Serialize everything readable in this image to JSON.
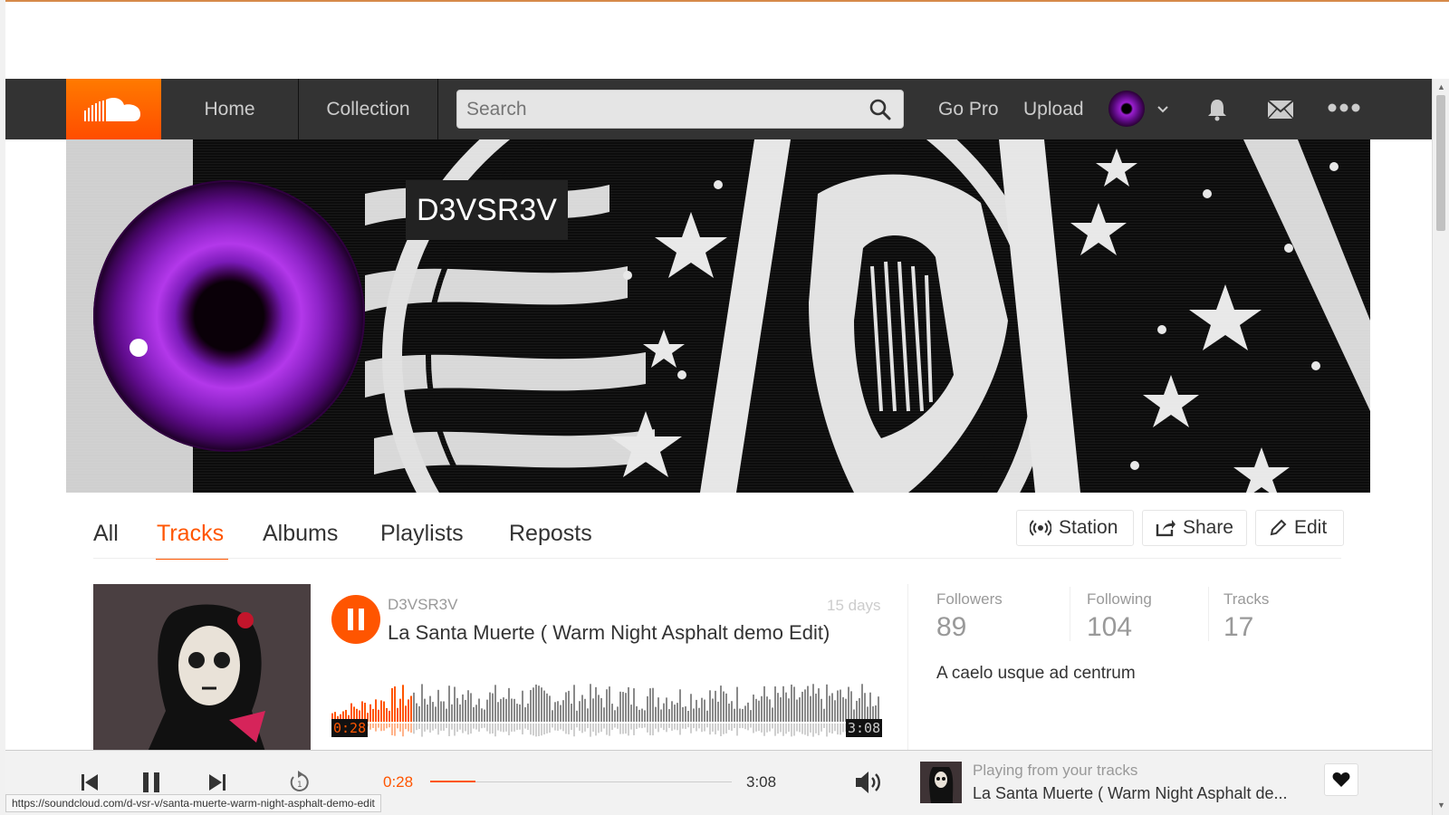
{
  "header": {
    "logo_icon": "soundcloud-cloud-icon",
    "nav": {
      "home": "Home",
      "collection": "Collection"
    },
    "search": {
      "placeholder": "Search",
      "value": ""
    },
    "go_pro": "Go Pro",
    "upload": "Upload",
    "icons": [
      "search-icon",
      "chevron-down-icon",
      "bell-icon",
      "mail-icon",
      "more-icon"
    ]
  },
  "profile": {
    "name": "D3VSR3V"
  },
  "tabs": {
    "all": "All",
    "tracks": "Tracks",
    "albums": "Albums",
    "playlists": "Playlists",
    "reposts": "Reposts",
    "active": "Tracks"
  },
  "actions": {
    "station": "Station",
    "share": "Share",
    "edit": "Edit"
  },
  "track": {
    "user": "D3VSR3V",
    "age": "15 days",
    "title": "La Santa Muerte ( Warm Night Asphalt demo Edit)",
    "time_start": "0:28",
    "time_end": "3:08",
    "progress": 0.149
  },
  "stats": {
    "followers_label": "Followers",
    "followers": "89",
    "following_label": "Following",
    "following": "104",
    "tracks_label": "Tracks",
    "tracks": "17"
  },
  "bio": "A caelo usque ad centrum",
  "player": {
    "current": "0:28",
    "duration": "3:08",
    "progress": 0.149,
    "context": "Playing from your tracks",
    "title": "La Santa Muerte ( Warm Night Asphalt de..."
  },
  "status_url": "https://soundcloud.com/d-vsr-v/santa-muerte-warm-night-asphalt-demo-edit",
  "colors": {
    "accent": "#ff5500",
    "header_bg": "#333333",
    "text": "#333333"
  }
}
